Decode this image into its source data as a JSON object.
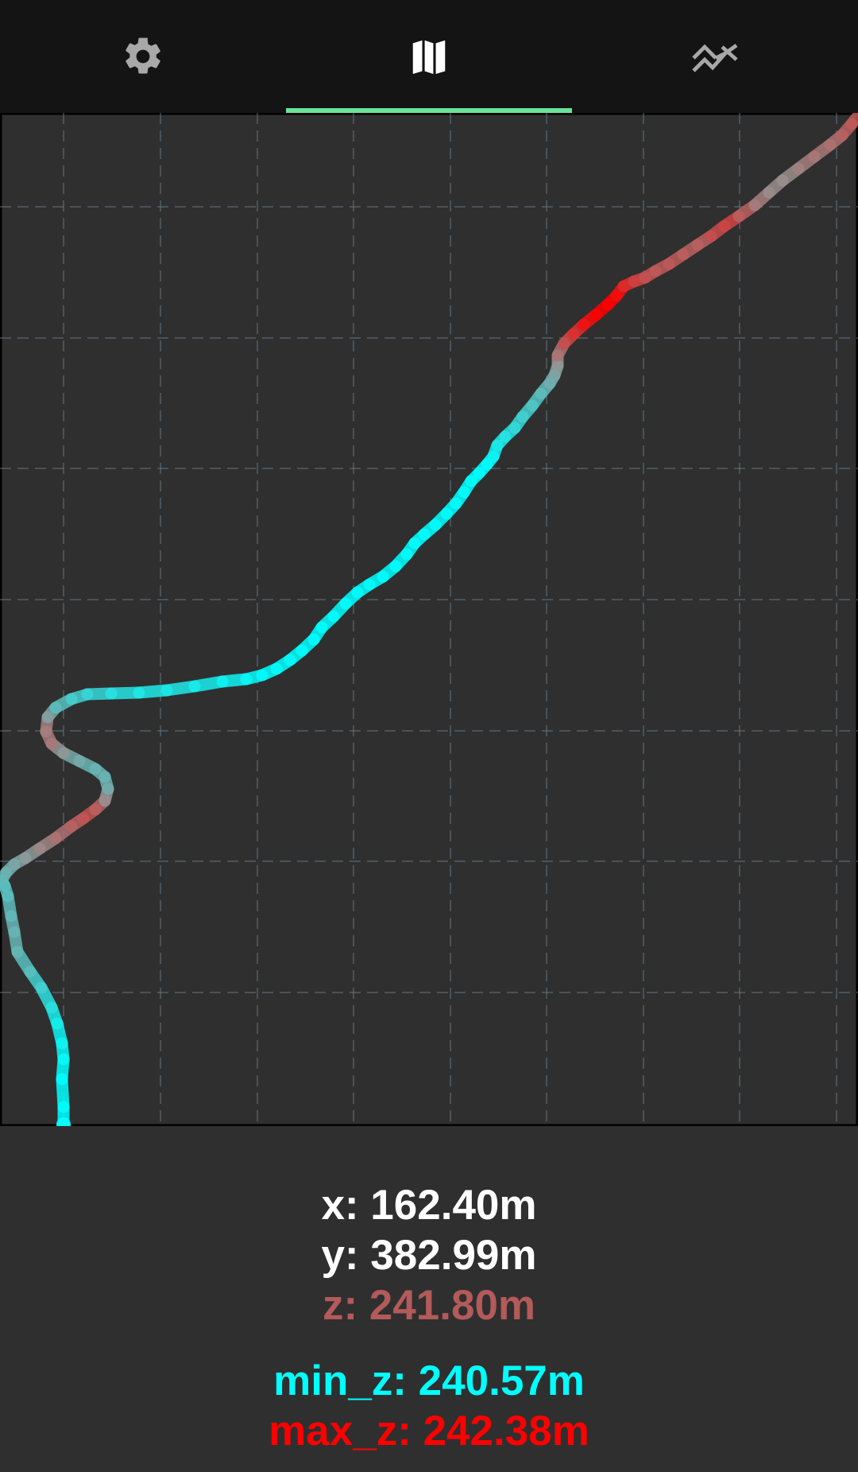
{
  "tabs": [
    {
      "id": "settings",
      "icon": "gear-icon",
      "active": false
    },
    {
      "id": "map",
      "icon": "map-icon",
      "active": true
    },
    {
      "id": "elevation",
      "icon": "elevation-chart-icon",
      "active": false
    }
  ],
  "colors": {
    "active_tab_indicator": "#69e39a",
    "low_elevation": "#00ffff",
    "high_elevation": "#ff0000",
    "current_z": "#b35a5a",
    "text": "#ffffff",
    "grid": "#6b7f8a"
  },
  "readout": {
    "x": "x: 162.40m",
    "y": "y: 382.99m",
    "z": "z: 241.80m",
    "min_z": "min_z: 240.57m",
    "max_z": "max_z: 242.38m"
  }
}
